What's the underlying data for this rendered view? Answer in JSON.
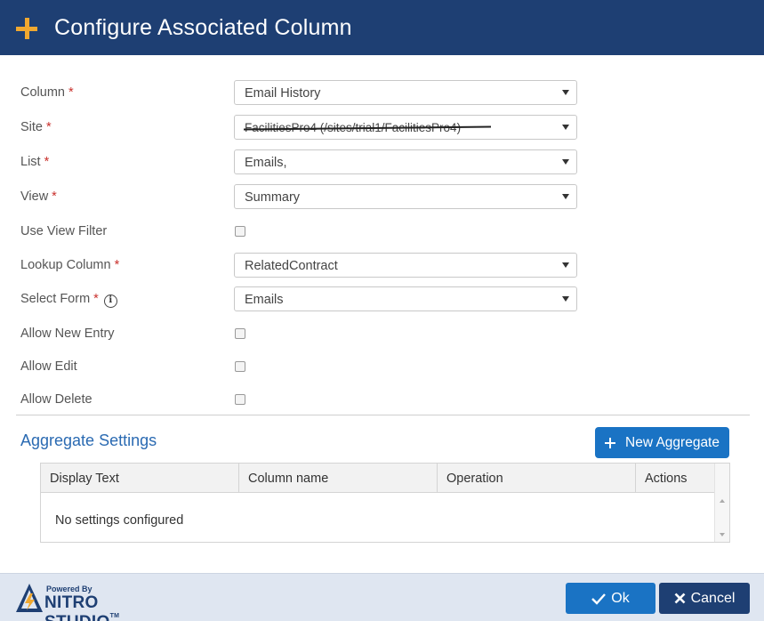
{
  "dialog": {
    "title": "Configure Associated Column"
  },
  "form": {
    "column": {
      "label": "Column",
      "required": "*",
      "value": "Email History"
    },
    "site": {
      "label": "Site",
      "required": "*",
      "value": "FacilitiesPro4 (/sites/trial1/FacilitiesPro4)"
    },
    "list": {
      "label": "List",
      "required": "*",
      "value": "Emails,"
    },
    "view": {
      "label": "View",
      "required": "*",
      "value": "Summary"
    },
    "use_view_filter": {
      "label": "Use View Filter",
      "checked": false
    },
    "lookup_column": {
      "label": "Lookup Column",
      "required": "*",
      "value": "RelatedContract"
    },
    "select_form": {
      "label": "Select Form",
      "required": "*",
      "value": "Emails",
      "info_icon": "info-circle-icon"
    },
    "allow_new_entry": {
      "label": "Allow New Entry",
      "checked": false
    },
    "allow_edit": {
      "label": "Allow Edit",
      "checked": false
    },
    "allow_delete": {
      "label": "Allow Delete",
      "checked": false
    }
  },
  "aggregate": {
    "title": "Aggregate Settings",
    "new_button": "New Aggregate",
    "columns": [
      "Display Text",
      "Column name",
      "Operation",
      "Actions"
    ],
    "empty_text": "No settings configured"
  },
  "footer": {
    "logo_powered": "Powered By",
    "logo_brand": "NITRO STUDIO",
    "logo_tm": "TM",
    "ok_label": "Ok",
    "cancel_label": "Cancel"
  },
  "colors": {
    "header_bg": "#1e3f73",
    "accent_orange": "#f0a830",
    "primary_blue": "#1a73c4",
    "link_blue": "#2a6ab2",
    "required_red": "#c9302c",
    "footer_bg": "#dfe6f1"
  }
}
